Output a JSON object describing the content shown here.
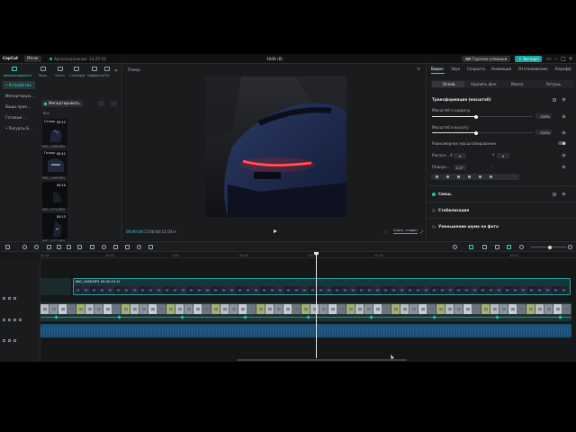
{
  "app": {
    "logo": "CapCut",
    "menu": "Меню",
    "autosave": "Автосохранение: 14:25:16",
    "project_title": "1006 (8)"
  },
  "header": {
    "hotkeys_button": "Горячие клавиши",
    "export_button": "Экспорт"
  },
  "media_tabs": [
    {
      "label": "Импортировать",
      "icon": "import-icon",
      "active": true
    },
    {
      "label": "Звук",
      "icon": "audio-icon",
      "active": false
    },
    {
      "label": "Текст",
      "icon": "text-icon",
      "active": false
    },
    {
      "label": "Стикеры",
      "icon": "sticker-icon",
      "active": false
    },
    {
      "label": "Эффекты",
      "icon": "effects-icon",
      "active": false
    },
    {
      "label": "Пе",
      "icon": "transition-icon",
      "active": false
    }
  ],
  "side_nav": [
    {
      "label": "• Устройство",
      "active": true
    },
    {
      "label": "Импортирую...",
      "active": false
    },
    {
      "label": "Ваши прое...",
      "active": false
    },
    {
      "label": "Готовые ...",
      "active": false
    },
    {
      "label": "• Ресурсы Б...",
      "active": false
    }
  ],
  "media": {
    "import_button": "Импортировать",
    "all_label": "Все",
    "thumbs": [
      {
        "status": "Готово",
        "duration": "00:12",
        "name": "IMG_1068.MP4"
      },
      {
        "status": "Готово",
        "duration": "00:11",
        "name": "IMG_1069.MP4"
      },
      {
        "status": "",
        "duration": "00:10",
        "name": "IMG_1070.MP4"
      },
      {
        "status": "",
        "duration": "00:13",
        "name": "IMG_1072.MP4"
      }
    ]
  },
  "player": {
    "title": "Плеер",
    "current_time": "00:00:04:17",
    "total_time": "00:00:11:04",
    "fit_label": "Соотн. сторон"
  },
  "props_tabs": [
    {
      "label": "Видео",
      "active": true
    },
    {
      "label": "Звук",
      "active": false
    },
    {
      "label": "Скорость",
      "active": false
    },
    {
      "label": "Анимация",
      "active": false
    },
    {
      "label": "Отслеживание",
      "active": false
    },
    {
      "label": "Корэфф",
      "active": false
    }
  ],
  "sub_tabs": [
    {
      "label": "Основ.",
      "active": true
    },
    {
      "label": "Удалить фон",
      "active": false
    },
    {
      "label": "Маска",
      "active": false
    },
    {
      "label": "Ретушь",
      "active": false
    }
  ],
  "props": {
    "transform_title": "Трансформация (масштаб)",
    "scale_width_label": "Масштаб в ширину",
    "scale_width_value": "100%",
    "scale_width_level": 0.44,
    "scale_height_label": "Масштаб в высоту",
    "scale_height_value": "100%",
    "scale_height_level": 0.44,
    "uniform_label": "Равномерное масштабирование",
    "position_label": "Распол...",
    "pos_x_prefix": "X",
    "pos_x": "0",
    "pos_y_prefix": "Y",
    "pos_y": "0",
    "rotate_label": "Поверн...",
    "rotate_value": "0.0°",
    "rotate_sep": "-",
    "blend_title": "Смеш.",
    "stabilize_title": "Стабилизация",
    "denoise_title": "Уменьшение шума на фото"
  },
  "timeline": {
    "ruler": [
      "00:00",
      "10:00",
      "1:00",
      "00:00",
      "1:00",
      "00:00",
      "10:00"
    ],
    "clip_label": "IMG_1068.MP4   00:00:10:11",
    "playhead_pct": 0.51
  },
  "colors": {
    "accent": "#3fd6cc",
    "export": "#14a6a0",
    "audio": "#1b4f74"
  }
}
